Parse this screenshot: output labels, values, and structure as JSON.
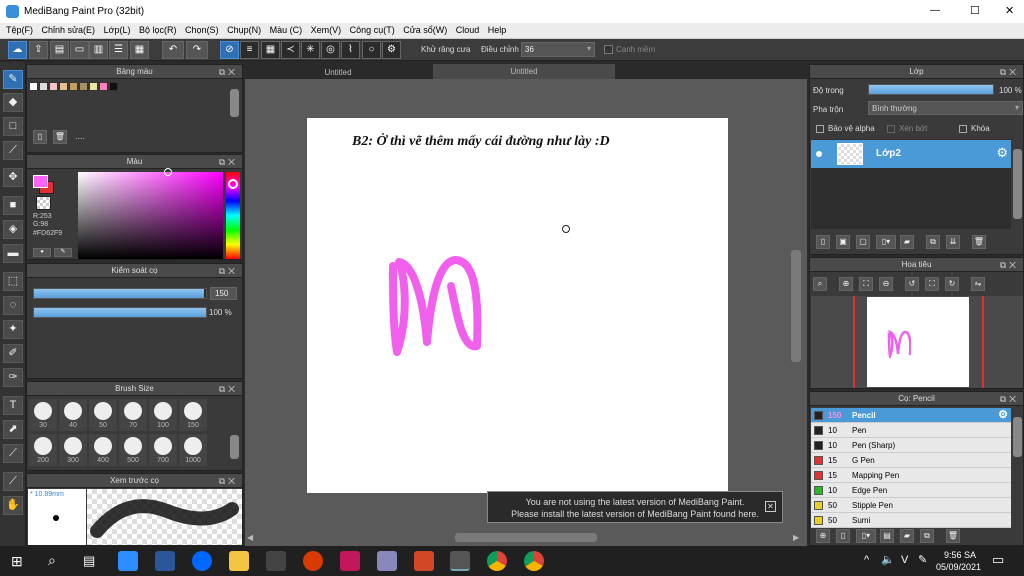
{
  "window": {
    "title": "MediBang Paint Pro (32bit)",
    "minimize": "—",
    "maximize": "☐",
    "close": "✕"
  },
  "menu": [
    "Tệp(F)",
    "Chỉnh sửa(E)",
    "Lớp(L)",
    "Bộ lọc(R)",
    "Chọn(S)",
    "Chụp(N)",
    "Màu (C)",
    "Xem(V)",
    "Công cụ(T)",
    "Cửa sổ(W)",
    "Cloud",
    "Help"
  ],
  "toolbar": {
    "antialias_label": "Khử răng cưa",
    "adjust_label": "Điều chỉnh",
    "adjust_value": "36",
    "sharp_label": "Cạnh mềm"
  },
  "panels": {
    "palette": {
      "title": "Bảng màu",
      "dots": "...."
    },
    "color": {
      "title": "Màu",
      "r": "R:253",
      "g": "G:98",
      "b": "B:249",
      "hex": "#FD62F9",
      "fg": "#fd62f9"
    },
    "brush_control": {
      "title": "Kiểm soát cọ",
      "size_value": "150",
      "opacity_value": "100 %",
      "size_fraction": 0.99,
      "opacity_fraction": 1.0
    },
    "brush_size": {
      "title": "Brush Size",
      "sizes": [
        "30",
        "40",
        "50",
        "70",
        "100",
        "150",
        "200",
        "300",
        "400",
        "500",
        "700",
        "1000"
      ]
    },
    "preview": {
      "title": "Xem trước cọ",
      "size": "* 10.89mm"
    }
  },
  "canvas": {
    "tabs": [
      "Untitled",
      "Untitled"
    ],
    "caption": "B2: Ở thì vẽ thêm mấy cái đường như lày :D",
    "stroke_color": "#f060ec"
  },
  "layer_panel": {
    "title": "Lớp",
    "opacity_label": "Độ trong",
    "opacity_value": "100 %",
    "opacity_fraction": 1.0,
    "blend_label": "Pha trộn",
    "blend_value": "Bình thường",
    "protect_alpha": "Bảo vệ alpha",
    "clipping": "Xén bớt",
    "lock": "Khóa",
    "layer_name": "Lớp2"
  },
  "navigator": {
    "title": "Hoa tiêu"
  },
  "pen_panel": {
    "title": "Cọ: Pencil",
    "pens": [
      {
        "size": "150",
        "name": "Pencil",
        "color": "#222222"
      },
      {
        "size": "10",
        "name": "Pen",
        "color": "#222222"
      },
      {
        "size": "10",
        "name": "Pen (Sharp)",
        "color": "#222222"
      },
      {
        "size": "15",
        "name": "G Pen",
        "color": "#e83030"
      },
      {
        "size": "15",
        "name": "Mapping Pen",
        "color": "#e83030"
      },
      {
        "size": "10",
        "name": "Edge Pen",
        "color": "#22bb22"
      },
      {
        "size": "50",
        "name": "Stipple Pen",
        "color": "#e8d020"
      },
      {
        "size": "50",
        "name": "Sumi",
        "color": "#e8d020"
      }
    ]
  },
  "notice": {
    "line1": "You are not using the latest version of MediBang Paint.",
    "line2": "Please install the latest version of MediBang Paint found here.",
    "close": "✕"
  },
  "taskbar": {
    "time": "9:56 SA",
    "date": "05/09/2021",
    "lang": "V",
    "tray_up": "^"
  }
}
